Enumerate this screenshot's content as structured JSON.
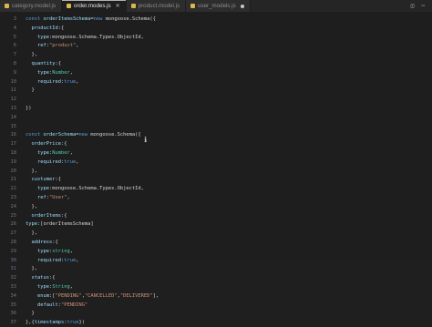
{
  "tabs": [
    {
      "label": "category.model.js",
      "active": false,
      "indicator": "none"
    },
    {
      "label": "order.modes.js",
      "active": true,
      "indicator": "close"
    },
    {
      "label": "product.model.js",
      "active": false,
      "indicator": "none"
    },
    {
      "label": "user_models.js",
      "active": false,
      "indicator": "dot"
    }
  ],
  "tab_actions": [
    "split-editor-icon",
    "more-actions-icon"
  ],
  "colors": {
    "keyword": "#569cd6",
    "variable": "#9cdcfe",
    "property": "#9cdcfe",
    "type": "#4ec9b0",
    "string": "#ce9178",
    "plain": "#d4d4d4",
    "line_number": "#6e7681"
  },
  "code_lines": [
    {
      "n": "3",
      "tokens": [
        [
          "kw",
          "const "
        ],
        [
          "var",
          "orderItemsSchema"
        ],
        [
          "p",
          "="
        ],
        [
          "kw",
          "new "
        ],
        [
          "p",
          "mongoose.Schema({"
        ]
      ]
    },
    {
      "n": "4",
      "tokens": [
        [
          "p",
          "  "
        ],
        [
          "prop",
          "productId"
        ],
        [
          "p",
          ":{"
        ]
      ]
    },
    {
      "n": "5",
      "tokens": [
        [
          "p",
          "    "
        ],
        [
          "prop",
          "type"
        ],
        [
          "p",
          ":mongoose.Schema.Types.ObjectId,"
        ]
      ]
    },
    {
      "n": "6",
      "tokens": [
        [
          "p",
          "    "
        ],
        [
          "prop",
          "ref"
        ],
        [
          "p",
          ":"
        ],
        [
          "str",
          "\"product\""
        ],
        [
          "p",
          ","
        ]
      ]
    },
    {
      "n": "7",
      "tokens": [
        [
          "p",
          "  },"
        ]
      ]
    },
    {
      "n": "8",
      "tokens": [
        [
          "p",
          "  "
        ],
        [
          "prop",
          "quantity"
        ],
        [
          "p",
          ":{"
        ]
      ]
    },
    {
      "n": "9",
      "tokens": [
        [
          "p",
          "    "
        ],
        [
          "prop",
          "type"
        ],
        [
          "p",
          ":"
        ],
        [
          "type",
          "Number"
        ],
        [
          "p",
          ","
        ]
      ]
    },
    {
      "n": "10",
      "tokens": [
        [
          "p",
          "    "
        ],
        [
          "prop",
          "required"
        ],
        [
          "p",
          ":"
        ],
        [
          "kw",
          "true"
        ],
        [
          "p",
          ","
        ]
      ]
    },
    {
      "n": "11",
      "tokens": [
        [
          "p",
          "  }"
        ]
      ]
    },
    {
      "n": "12",
      "tokens": [
        [
          "p",
          ""
        ]
      ]
    },
    {
      "n": "13",
      "tokens": [
        [
          "p",
          "})"
        ]
      ]
    },
    {
      "n": "14",
      "tokens": [
        [
          "p",
          ""
        ]
      ]
    },
    {
      "n": "15",
      "tokens": [
        [
          "p",
          ""
        ]
      ]
    },
    {
      "n": "16",
      "tokens": [
        [
          "kw",
          "const "
        ],
        [
          "var",
          "orderSchema"
        ],
        [
          "p",
          "="
        ],
        [
          "kw",
          "new "
        ],
        [
          "p",
          "mongoose.Schema({"
        ]
      ]
    },
    {
      "n": "17",
      "tokens": [
        [
          "p",
          "  "
        ],
        [
          "prop",
          "orderPrice"
        ],
        [
          "p",
          ":{"
        ]
      ]
    },
    {
      "n": "18",
      "tokens": [
        [
          "p",
          "    "
        ],
        [
          "prop",
          "type"
        ],
        [
          "p",
          ":"
        ],
        [
          "type",
          "Number"
        ],
        [
          "p",
          ","
        ]
      ]
    },
    {
      "n": "19",
      "tokens": [
        [
          "p",
          "    "
        ],
        [
          "prop",
          "required"
        ],
        [
          "p",
          ":"
        ],
        [
          "kw",
          "true"
        ],
        [
          "p",
          ","
        ]
      ]
    },
    {
      "n": "20",
      "tokens": [
        [
          "p",
          "  },"
        ]
      ]
    },
    {
      "n": "21",
      "tokens": [
        [
          "p",
          "  "
        ],
        [
          "prop",
          "custumer"
        ],
        [
          "p",
          ":{"
        ]
      ]
    },
    {
      "n": "22",
      "tokens": [
        [
          "p",
          "    "
        ],
        [
          "prop",
          "type"
        ],
        [
          "p",
          ":mongoose.Schema.Types.ObjectId,"
        ]
      ]
    },
    {
      "n": "23",
      "tokens": [
        [
          "p",
          "    "
        ],
        [
          "prop",
          "ref"
        ],
        [
          "p",
          ":"
        ],
        [
          "str",
          "\"User\""
        ],
        [
          "p",
          ","
        ]
      ]
    },
    {
      "n": "24",
      "tokens": [
        [
          "p",
          "  },"
        ]
      ]
    },
    {
      "n": "25",
      "tokens": [
        [
          "p",
          "  "
        ],
        [
          "prop",
          "orderItems"
        ],
        [
          "p",
          ":{"
        ]
      ]
    },
    {
      "n": "26",
      "tokens": [
        [
          "prop",
          "type"
        ],
        [
          "p",
          ":[orderItemsSchema]"
        ]
      ]
    },
    {
      "n": "27",
      "tokens": [
        [
          "p",
          "  },"
        ]
      ]
    },
    {
      "n": "28",
      "tokens": [
        [
          "p",
          "  "
        ],
        [
          "prop",
          "address"
        ],
        [
          "p",
          ":{"
        ]
      ]
    },
    {
      "n": "29",
      "tokens": [
        [
          "p",
          "    "
        ],
        [
          "prop",
          "type"
        ],
        [
          "p",
          ":"
        ],
        [
          "type",
          "string"
        ],
        [
          "p",
          ","
        ]
      ]
    },
    {
      "n": "30",
      "tokens": [
        [
          "p",
          "    "
        ],
        [
          "prop",
          "required"
        ],
        [
          "p",
          ":"
        ],
        [
          "kw",
          "true"
        ],
        [
          "p",
          ","
        ]
      ]
    },
    {
      "n": "31",
      "tokens": [
        [
          "p",
          "  },"
        ]
      ]
    },
    {
      "n": "32",
      "tokens": [
        [
          "p",
          "  "
        ],
        [
          "prop",
          "status"
        ],
        [
          "p",
          ":{"
        ]
      ]
    },
    {
      "n": "33",
      "tokens": [
        [
          "p",
          "    "
        ],
        [
          "prop",
          "type"
        ],
        [
          "p",
          ":"
        ],
        [
          "type",
          "String"
        ],
        [
          "p",
          ","
        ]
      ]
    },
    {
      "n": "34",
      "tokens": [
        [
          "p",
          "    "
        ],
        [
          "prop",
          "enum"
        ],
        [
          "p",
          ":["
        ],
        [
          "str",
          "\"PENDING\""
        ],
        [
          "p",
          ","
        ],
        [
          "str",
          "\"CANCELLED\""
        ],
        [
          "p",
          ","
        ],
        [
          "str",
          "\"DELIVERED\""
        ],
        [
          "p",
          "],"
        ]
      ]
    },
    {
      "n": "35",
      "tokens": [
        [
          "p",
          "    "
        ],
        [
          "prop",
          "default"
        ],
        [
          "p",
          ":"
        ],
        [
          "str",
          "\"PENDING\""
        ]
      ]
    },
    {
      "n": "36",
      "tokens": [
        [
          "p",
          "  }"
        ]
      ]
    },
    {
      "n": "37",
      "tokens": [
        [
          "p",
          "},{"
        ],
        [
          "prop",
          "timestamps"
        ],
        [
          "p",
          ":"
        ],
        [
          "kw",
          "true"
        ],
        [
          "p",
          "})"
        ]
      ]
    }
  ]
}
